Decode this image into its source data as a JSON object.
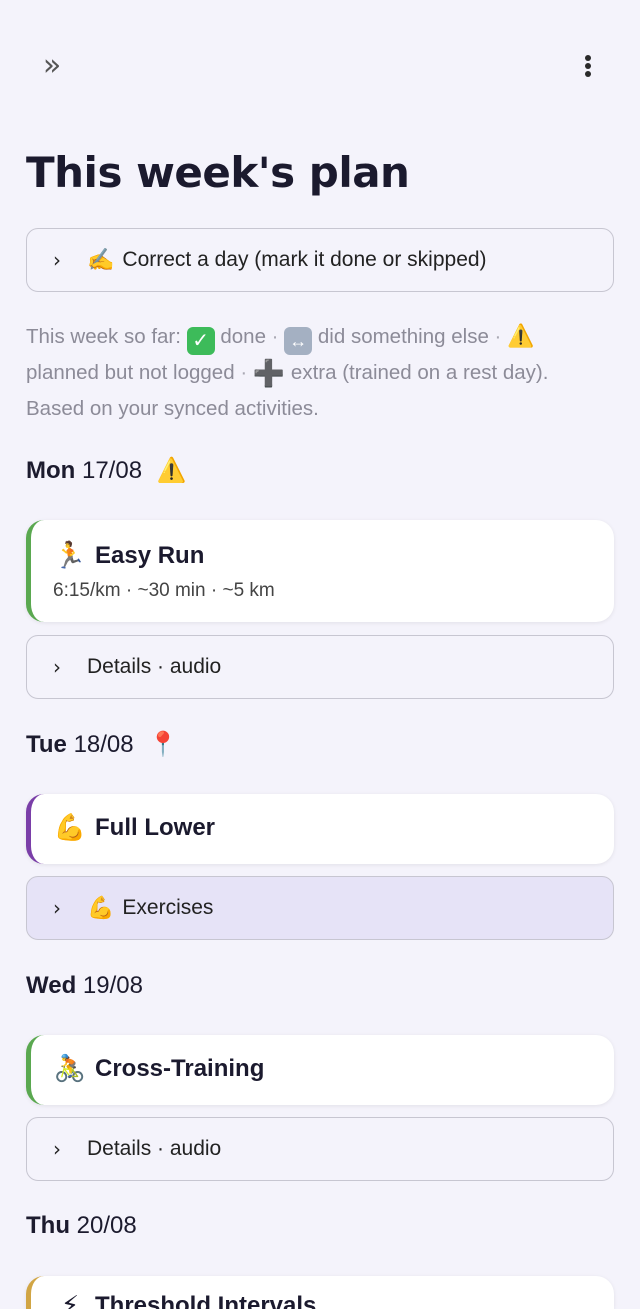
{
  "topbar": {
    "expand_icon": "double-chevron-right-icon",
    "expand_glyph": "»",
    "menu_icon": "vertical-dots-icon"
  },
  "page": {
    "title": "This week's plan"
  },
  "correct_day": {
    "chevron": "›",
    "icon": "writing-hand-icon",
    "icon_glyph": "✍️",
    "label": "Correct a day (mark it done or skipped)"
  },
  "legend": {
    "lead": "This week so far:",
    "done_glyph": "✓",
    "done_label": "done",
    "else_glyph": "↔",
    "else_label": "did something else",
    "warn_glyph": "⚠️",
    "warn_label": "planned but not logged",
    "extra_glyph": "➕",
    "extra_label": "extra (trained on a rest day).",
    "note": "Based on your synced activities.",
    "sep": "·"
  },
  "days": [
    {
      "day": "Mon",
      "date": "17/08",
      "status_icon": "warning-icon",
      "status_glyph": "⚠️",
      "workout": {
        "icon": "runner-icon",
        "icon_glyph": "🏃",
        "title": "Easy Run",
        "subtitle": "6:15/km · ~30 min · ~5 km",
        "accent": "#5aa850"
      },
      "expander": {
        "chevron": "›",
        "label": "Details · audio"
      }
    },
    {
      "day": "Tue",
      "date": "18/08",
      "status_icon": "pushpin-icon",
      "status_glyph": "📍",
      "workout": {
        "icon": "flexed-biceps-icon",
        "icon_glyph": "💪",
        "title": "Full Lower",
        "accent": "#7a3ea8"
      },
      "expander": {
        "chevron": "›",
        "icon": "flexed-biceps-icon",
        "icon_glyph": "💪",
        "label": "Exercises"
      }
    },
    {
      "day": "Wed",
      "date": "19/08",
      "workout": {
        "icon": "cyclist-icon",
        "icon_glyph": "🚴",
        "title": "Cross-Training",
        "accent": "#5aa850"
      },
      "expander": {
        "chevron": "›",
        "label": "Details · audio"
      }
    },
    {
      "day": "Thu",
      "date": "20/08",
      "workout": {
        "icon": "lightning-icon",
        "icon_glyph": "⚡",
        "title": "Threshold Intervals",
        "accent": "#d1a544"
      }
    }
  ]
}
